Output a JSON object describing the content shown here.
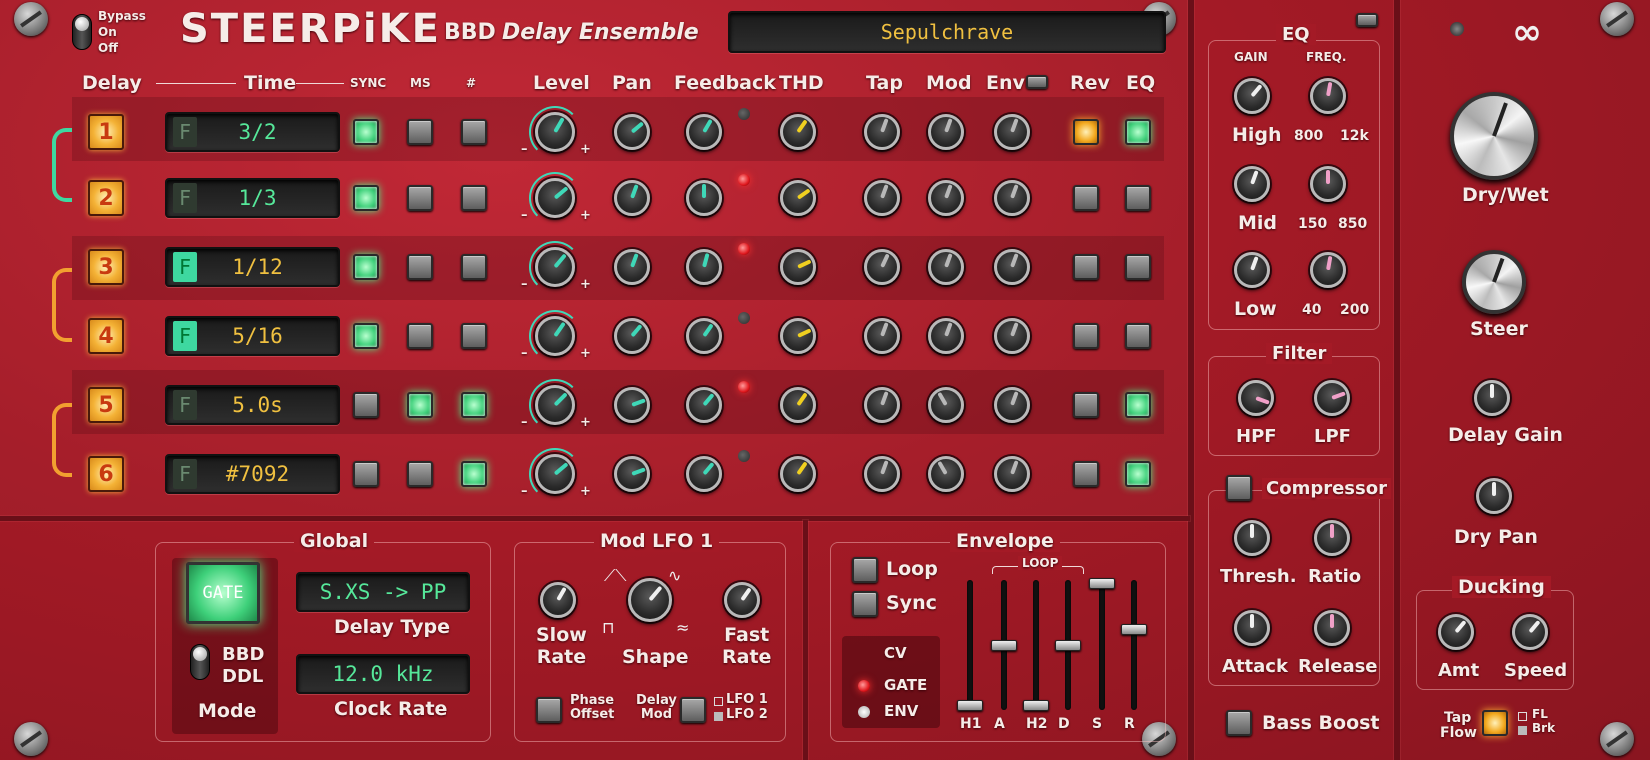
{
  "header": {
    "logo": "STEERPiKE",
    "subtitle_bbd": "BBD",
    "subtitle_rest": "Delay Ensemble",
    "preset": "Sepulchrave",
    "bypass": [
      "Bypass",
      "On",
      "Off"
    ]
  },
  "columns": {
    "delay": "Delay",
    "time": "Time",
    "sync": "SYNC",
    "ms": "MS",
    "hash": "#",
    "level": "Level",
    "pan": "Pan",
    "feedback": "Feedback",
    "thd": "THD",
    "tap": "Tap",
    "mod": "Mod",
    "env": "Env",
    "rev": "Rev",
    "eq": "EQ"
  },
  "rows": [
    {
      "num": "1",
      "f": "F",
      "time": "3/2"
    },
    {
      "num": "2",
      "f": "F",
      "time": "1/3"
    },
    {
      "num": "3",
      "f": "F",
      "time": "1/12"
    },
    {
      "num": "4",
      "f": "F",
      "time": "5/16"
    },
    {
      "num": "5",
      "f": "F",
      "time": "5.0s"
    },
    {
      "num": "6",
      "f": "F",
      "time": "#7092"
    }
  ],
  "eq": {
    "title": "EQ",
    "gain": "GAIN",
    "freq": "FREQ.",
    "high": "High",
    "mid": "Mid",
    "low": "Low",
    "high_lo": "800",
    "high_hi": "12k",
    "mid_lo": "150",
    "mid_hi": "850",
    "low_lo": "40",
    "low_hi": "200"
  },
  "filter": {
    "title": "Filter",
    "hpf": "HPF",
    "lpf": "LPF"
  },
  "compressor": {
    "title": "Compressor",
    "thresh": "Thresh.",
    "ratio": "Ratio",
    "attack": "Attack",
    "release": "Release",
    "bass_boost": "Bass Boost"
  },
  "master": {
    "drywet": "Dry/Wet",
    "steer": "Steer",
    "delay_gain": "Delay Gain",
    "dry_pan": "Dry Pan",
    "ducking": "Ducking",
    "amt": "Amt",
    "speed": "Speed",
    "tap": "Tap",
    "flow": "Flow",
    "fl": "FL",
    "brk": "Brk"
  },
  "global": {
    "title": "Global",
    "gate": "GATE",
    "bbd": "BBD",
    "ddl": "DDL",
    "mode": "Mode",
    "delay_type_value": "S.XS -> PP",
    "delay_type": "Delay Type",
    "clock_value": "12.0 kHz",
    "clock_rate": "Clock Rate"
  },
  "lfo": {
    "title": "Mod LFO 1",
    "slow": "Slow",
    "slow2": "Rate",
    "shape": "Shape",
    "fast": "Fast",
    "fast2": "Rate",
    "phase": "Phase",
    "offset": "Offset",
    "delay": "Delay",
    "mod": "Mod",
    "lfo1": "LFO 1",
    "lfo2": "LFO 2"
  },
  "envelope": {
    "title": "Envelope",
    "loop": "Loop",
    "sync": "Sync",
    "cv": "CV",
    "gate": "GATE",
    "env": "ENV",
    "loop_bracket": "LOOP",
    "sliders": [
      "H1",
      "A",
      "H2",
      "D",
      "S",
      "R"
    ]
  },
  "colors": {
    "panel": "#a41a26",
    "led_green": "#4ef08a",
    "teal": "#3fd8b8",
    "yellow": "#f0d020",
    "pink": "#f0a0c8",
    "lcd_green": "#56e89a",
    "lcd_yellow": "#f0c040"
  }
}
